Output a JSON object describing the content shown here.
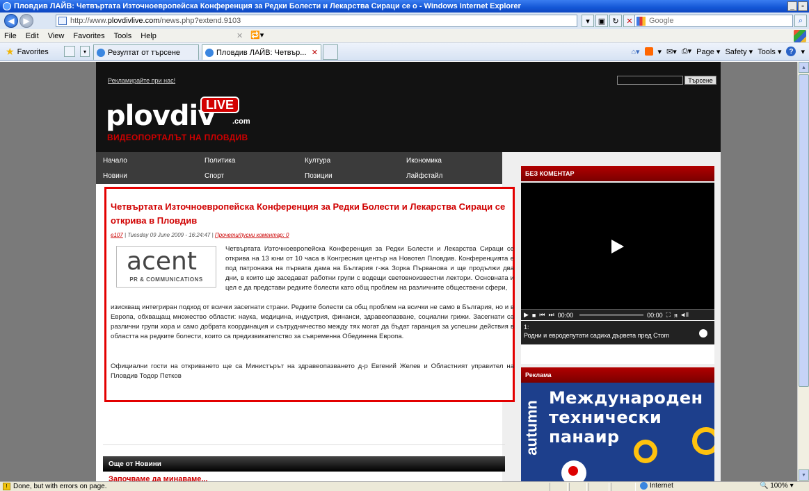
{
  "window": {
    "title": "Пловдив ЛАЙВ: Четвъртата Източноевропейска Конференция за Редки Болести и Лекарства Сираци се о - Windows Internet Explorer"
  },
  "address_bar": {
    "url_prefix": "http://www.",
    "url_domain": "plovdivlive.com",
    "url_path": "/news.php?extend.9103",
    "search_placeholder": "Google"
  },
  "menu": {
    "items": [
      "File",
      "Edit",
      "View",
      "Favorites",
      "Tools",
      "Help"
    ]
  },
  "favorites_bar": {
    "favorites_label": "Favorites",
    "tabs": [
      {
        "label": "Резултат от търсене"
      },
      {
        "label": "Пловдив ЛАЙВ: Четвър..."
      }
    ],
    "commands": [
      "Page",
      "Safety",
      "Tools"
    ]
  },
  "site": {
    "advertise_link": "Рекламирайте при нас!",
    "search_button": "Търсене",
    "logo": {
      "main": "plovdiv",
      "live": "LIVE",
      "com": ".com",
      "tagline": "ВИДЕОПОРТАЛЪТ НА ПЛОВДИВ"
    },
    "nav": {
      "row1": [
        "Начало",
        "Политика",
        "Култура",
        "Икономика"
      ],
      "row2": [
        "Новини",
        "Спорт",
        "Позиции",
        "Лайфстайл"
      ]
    },
    "article": {
      "title": "Четвъртата Източноевропейска Конференция за Редки Болести и Лекарства Сираци се открива в Пловдив",
      "author": "e107",
      "date": " | Tuesday 09 June 2009 - 16:24:47 | ",
      "comments_link": "Прочети/пусни коментар: 0",
      "image_logo_text": "acent",
      "image_logo_sub": "PR & COMMUNICATIONS",
      "paragraph1": "Четвъртата Източноевропейска Конференция за Редки Болести и Лекарства Сираци се открива на 13 юни от 10 часа в Конгресния център на Новотел Пловдив. Конференцията е под патронажа на първата дама на България г-жа Зорка Първанова и ще продължи два дни, в които ще заседават работни групи с водещи световноизвестни лектори. Основната и цел е да представи редките болести като общ проблем на различните обществени сфери,",
      "paragraph2": "изискващ интегриран подход от всички засегнати страни. Редките болести са общ проблем на всички не само в България, но и в Европа, обхващащ множество области: наука, медицина, индустрия, финанси, здравеопазване, социални грижи. Засегнати са различни групи хора и само добрата координация и сътрудничество между тях могат да бъдат гаранция за успешни действия в областта на редките болести, които са предизвикателство за съвременна Обединена Европа.",
      "paragraph3": "Официални гости на откриването ще са Министърът на здравеопазването д-р Евгений Желев и Областният управител на Пловдив Тодор Петков"
    },
    "more_news": {
      "header": "Още от Новини",
      "next_item": "Започваме да минаваме..."
    },
    "no_comment": {
      "header": "БЕЗ КОМЕНТАР",
      "time_start": "00:00",
      "time_end": "00:00",
      "playlist_index": "1:",
      "playlist_title": "Родни и евродепутати садиха дървета пред Стоm"
    },
    "ads": {
      "header": "Реклама",
      "vertical": "autumn",
      "line1": "Международен",
      "line2": "технически",
      "line3": "панаир"
    }
  },
  "status_bar": {
    "message": "Done, but with errors on page.",
    "zone": "Internet",
    "zoom": "100%"
  }
}
